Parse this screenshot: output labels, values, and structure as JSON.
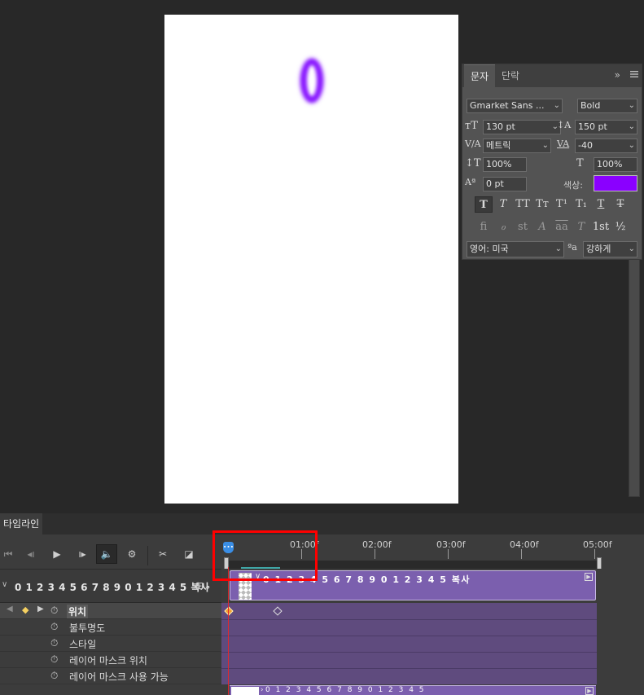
{
  "canvas": {
    "glyph_text": "0",
    "glyph_color": "#8a1aff"
  },
  "character_panel": {
    "tabs": [
      "문자",
      "단락"
    ],
    "expand_icon": "»",
    "menu_icon": "hamburger-icon",
    "font_family": "Gmarket Sans ...",
    "font_style": "Bold",
    "font_size": "130 pt",
    "leading": "150 pt",
    "kerning": "메트릭",
    "tracking": "-40",
    "vertical_scale": "100%",
    "horizontal_scale": "100%",
    "baseline_shift": "0 pt",
    "color_label": "색상:",
    "color_value": "#8a00ff",
    "style_buttons": [
      "T",
      "T",
      "TT",
      "Tт",
      "T¹",
      "T₁",
      "T",
      "T"
    ],
    "opentype_buttons": [
      "ﬁ",
      "ℴ",
      "st",
      "A",
      "aa",
      "T",
      "1st",
      "½"
    ],
    "language": "영어: 미국",
    "aa_icon": "ªa",
    "antialias": "강하게"
  },
  "timeline": {
    "tab_label": "타임라인",
    "ruler_labels": [
      "01:00f",
      "02:00f",
      "03:00f",
      "04:00f",
      "05:00f"
    ],
    "layer_name": "0 1 2 3 4 5 6 7 8 9 0 1 2 3 4 5 복사",
    "clip_label": "0 1 2 3 4 5 6 7 8 9 0 1 2 3 4 5 복사",
    "second_clip_label": "0 1 2 3 4 5 6 7 8 9 0 1 2 3 4 5",
    "properties": [
      "위치",
      "불투명도",
      "스타일",
      "레이어 마스크 위치",
      "레이어 마스크 사용 가능"
    ],
    "playhead_icon": "∙∙∙"
  },
  "colors": {
    "clip_purple": "#7b5fae",
    "track_purple": "#5f4b7e",
    "playhead_blue": "#3a8ee6",
    "playhead_red": "#e0282d",
    "keyframe_active": "#f0a030",
    "highlight_red": "#ff0000"
  }
}
